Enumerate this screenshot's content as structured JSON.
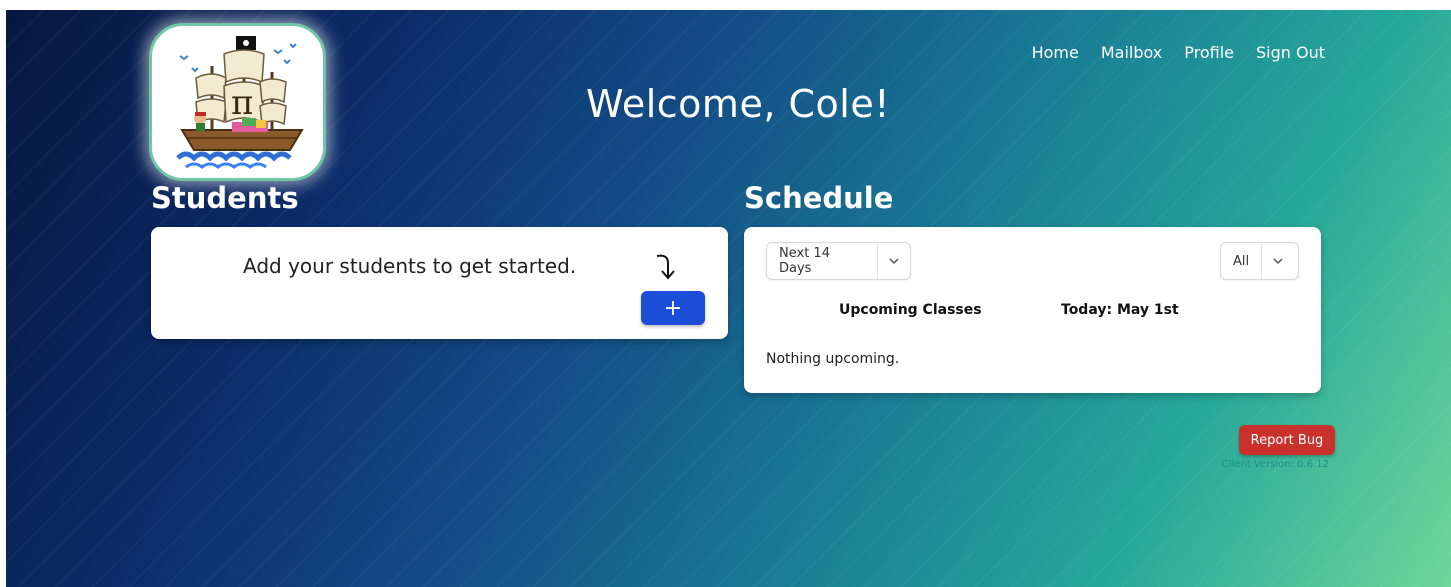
{
  "nav": {
    "items": [
      {
        "label": "Home"
      },
      {
        "label": "Mailbox"
      },
      {
        "label": "Profile"
      },
      {
        "label": "Sign Out"
      }
    ]
  },
  "header": {
    "welcome": "Welcome, Cole!",
    "logo_icon": "pi-pirate-ship-logo"
  },
  "students": {
    "title": "Students",
    "empty_message": "Add your students to get started.",
    "add_button_label": "+",
    "arrow_icon": "curved-arrow-down-icon"
  },
  "schedule": {
    "title": "Schedule",
    "range_select": "Next 14 Days",
    "filter_select": "All",
    "upcoming_heading": "Upcoming Classes",
    "today_heading": "Today: May 1st",
    "empty_message": "Nothing upcoming."
  },
  "footer": {
    "report_bug_label": "Report Bug",
    "client_version": "Client Version: 0.6.12"
  },
  "colors": {
    "accent_blue": "#1d4ed8",
    "report_red": "#c8312c",
    "background_start": "#07173f",
    "background_end": "#6fd69a"
  }
}
